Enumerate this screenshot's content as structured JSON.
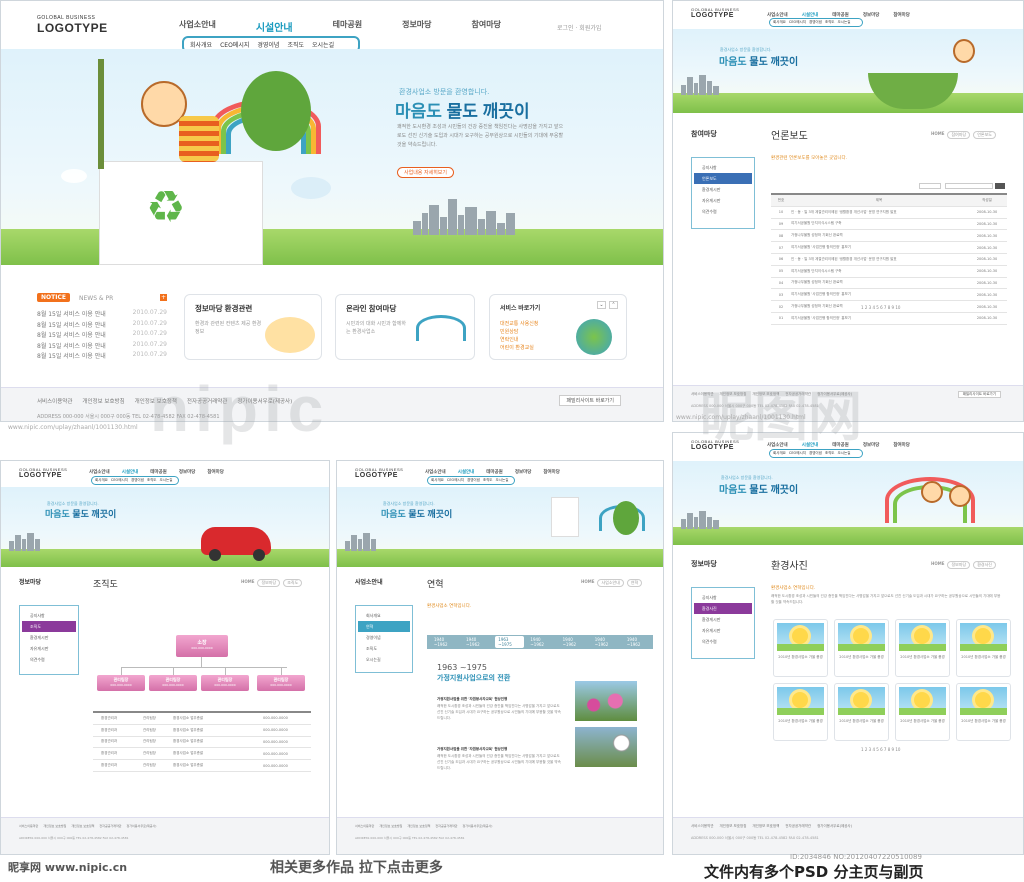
{
  "logo": {
    "line1": "GOLOBAL BUSINESS",
    "line2": "LOGOTYPE"
  },
  "gnav": [
    "사업소안내",
    "시설안내",
    "테마공원",
    "정보마당",
    "참여마당"
  ],
  "util": [
    "로그인",
    "회원가입"
  ],
  "subnav": [
    "회사개요",
    "CEO메시지",
    "경영이념",
    "조직도",
    "오시는길"
  ],
  "hero": {
    "small": "환경사업소 방문을 환영합니다.",
    "title_a": "마음도",
    "title_b": "물도 깨끗이",
    "desc": "쾌적한 도시환경 조성과 시민들의 건강 증진을 책임진다는 사명감을 가지고 앞으로도 선진 신기술 도입과 시대가 요구하는 공무원상으로 시민들의 기대에 부응할 것을 약속드립니다.",
    "button": "사업내용 자세히보기"
  },
  "notice": {
    "tab": "NOTICE",
    "tab2": "NEWS & PR",
    "items": [
      {
        "text": "8월 15일 서비스 이용 안내",
        "date": "2010.07.29"
      },
      {
        "text": "8월 15일 서비스 이용 안내",
        "date": "2010.07.29"
      },
      {
        "text": "8월 15일 서비스 이용 안내",
        "date": "2010.07.29"
      },
      {
        "text": "8월 15일 서비스 이용 안내",
        "date": "2010.07.29"
      },
      {
        "text": "8월 15일 서비스 이용 안내",
        "date": "2010.07.29"
      }
    ]
  },
  "cards": [
    {
      "title": "정보마당 환경관련",
      "desc": "환경과 관련된 컨텐츠 제공 환경정보"
    },
    {
      "title": "온라인 참여마당",
      "desc": "시민과의 대화 시민과 함께하는 환경사업소"
    },
    {
      "title": "서비스 바로가기",
      "links": [
        "대전교통 사용신청",
        "민원상담",
        "연락인내",
        "어린이 환경교실"
      ]
    }
  ],
  "footer": {
    "links": [
      "서비스이용약관",
      "개인정보 보호방침",
      "개인정보 보호정책",
      "전자공공거래약관",
      "정가이용서우로(제공사)"
    ],
    "family": "패밀리사이트 바로가기",
    "address": "ADDRESS 000-000 서울시 000구 000동 TEL 02-478-4582 FAX 02-478-4581"
  },
  "news_page": {
    "side_title": "참여마당",
    "side_items": [
      "공지사항",
      "언론보도",
      "환경게시판",
      "자유게시판",
      "의견수렴"
    ],
    "title": "언론보도",
    "intro": "환경관련 언론보도를 모아놓은 곳입니다.",
    "crumb": [
      "HOME",
      "참여마당",
      "언론보도"
    ],
    "headers": [
      "번호",
      "제목",
      "작성일"
    ],
    "rows": [
      {
        "no": "10",
        "title": "인 · 동 · 일 3개 계절관리이에된 '생활환경 개선사업' 운영 연구지원 발표",
        "date": "2008-10-30"
      },
      {
        "no": "09",
        "title": "여기서공물원 단지이식시스템 구축",
        "date": "2008-10-30"
      },
      {
        "no": "08",
        "title": "가정나무물원 성정하 기회신 완료쩍",
        "date": "2008-10-30"
      },
      {
        "no": "07",
        "title": "여기서공물원 '사업진행 합의인정' 홍보기",
        "date": "2008-10-30"
      },
      {
        "no": "06",
        "title": "인 · 동 · 일 3개 계절관리이에된 '생활환경 개선사업' 운영 연구지원 발표",
        "date": "2008-10-30"
      },
      {
        "no": "05",
        "title": "여기서공물원 단지이식시스템 구축",
        "date": "2008-10-30"
      },
      {
        "no": "04",
        "title": "가정나무물원 성정하 기회신 완료쩍",
        "date": "2008-10-30"
      },
      {
        "no": "03",
        "title": "여기서공물원 '사업진행 합의인정' 홍보기",
        "date": "2008-10-30"
      },
      {
        "no": "02",
        "title": "가정나무물원 성정하 기회신 완료쩍",
        "date": "2008-10-30"
      },
      {
        "no": "01",
        "title": "여기서공물원 '사업진행 합의인정' 홍보기",
        "date": "2008-10-30"
      }
    ],
    "pages": "1 2 3 4 5 6 7 8 9 10"
  },
  "org_page": {
    "side_title": "정보마당",
    "side_items": [
      "공지사항",
      "조직도",
      "환경게시판",
      "자유게시판",
      "의견수렴"
    ],
    "title": "조직도",
    "top": "소장",
    "top_sub": "000-000-0000",
    "depts": [
      "관리팀장",
      "관리팀장",
      "관리팀장",
      "관리팀장"
    ],
    "rows": [
      {
        "a": "환경관리과",
        "b": "관리팀장",
        "c": "환경사업소 업무총괄",
        "d": "000-000-0000"
      },
      {
        "a": "환경관리과",
        "b": "관리팀장",
        "c": "환경사업소 업무총괄",
        "d": "000-000-0000"
      },
      {
        "a": "환경관리과",
        "b": "관리팀장",
        "c": "환경사업소 업무총괄",
        "d": "000-000-0000"
      },
      {
        "a": "환경관리과",
        "b": "관리팀장",
        "c": "환경사업소 업무총괄",
        "d": "000-000-0000"
      },
      {
        "a": "환경관리과",
        "b": "관리팀장",
        "c": "환경사업소 업무총괄",
        "d": "000-000-0000"
      }
    ]
  },
  "hist_page": {
    "side_title": "사업소안내",
    "side_items": [
      "회사개요",
      "연혁",
      "경영이념",
      "조직도",
      "오시는길"
    ],
    "title": "연혁",
    "intro": "환경사업소 연혁입니다.",
    "years": [
      "1940 ~1962",
      "1940 ~1962",
      "1963 ~1975",
      "1940 ~1962",
      "1940 ~1962",
      "1940 ~1962",
      "1940 ~1962"
    ],
    "range": "1963 ~1975",
    "heading": "가정지원사업으로의 전환",
    "item1": "가정지원사업을 위한 '자원봉사자교육' 협상진행",
    "item2": "가정지원사업을 위한 '자원봉사자교육' 협상진행"
  },
  "photo_page": {
    "side_title": "정보마당",
    "side_items": [
      "공지사항",
      "환경사진",
      "환경게시판",
      "자유게시판",
      "의견수렴"
    ],
    "title": "환경사진",
    "intro": "환경사업소 연혁입니다.",
    "caption": "2010년 환경사업소 가을 풍경"
  },
  "watermarks": {
    "big": "nipic",
    "cn1": "昵图网",
    "cn2": "昵享网",
    "urls": [
      "www.nipic.com/uplay/zhaanl/1001130.html",
      "www.nipic.com/uplay/zhaanl/1001130.html"
    ]
  },
  "bottom": {
    "site": "昵享网 www.nipic.cn",
    "center": "相关更多作品  拉下点击更多",
    "id": "ID:2034846 NO:20120407220510089",
    "note": "文件内有多个PSD 分主页与副页"
  },
  "colors": {
    "accent": "#1a9bbf",
    "orange": "#f2711c",
    "pink": "#d470a8",
    "purple": "#8b3a9b"
  }
}
